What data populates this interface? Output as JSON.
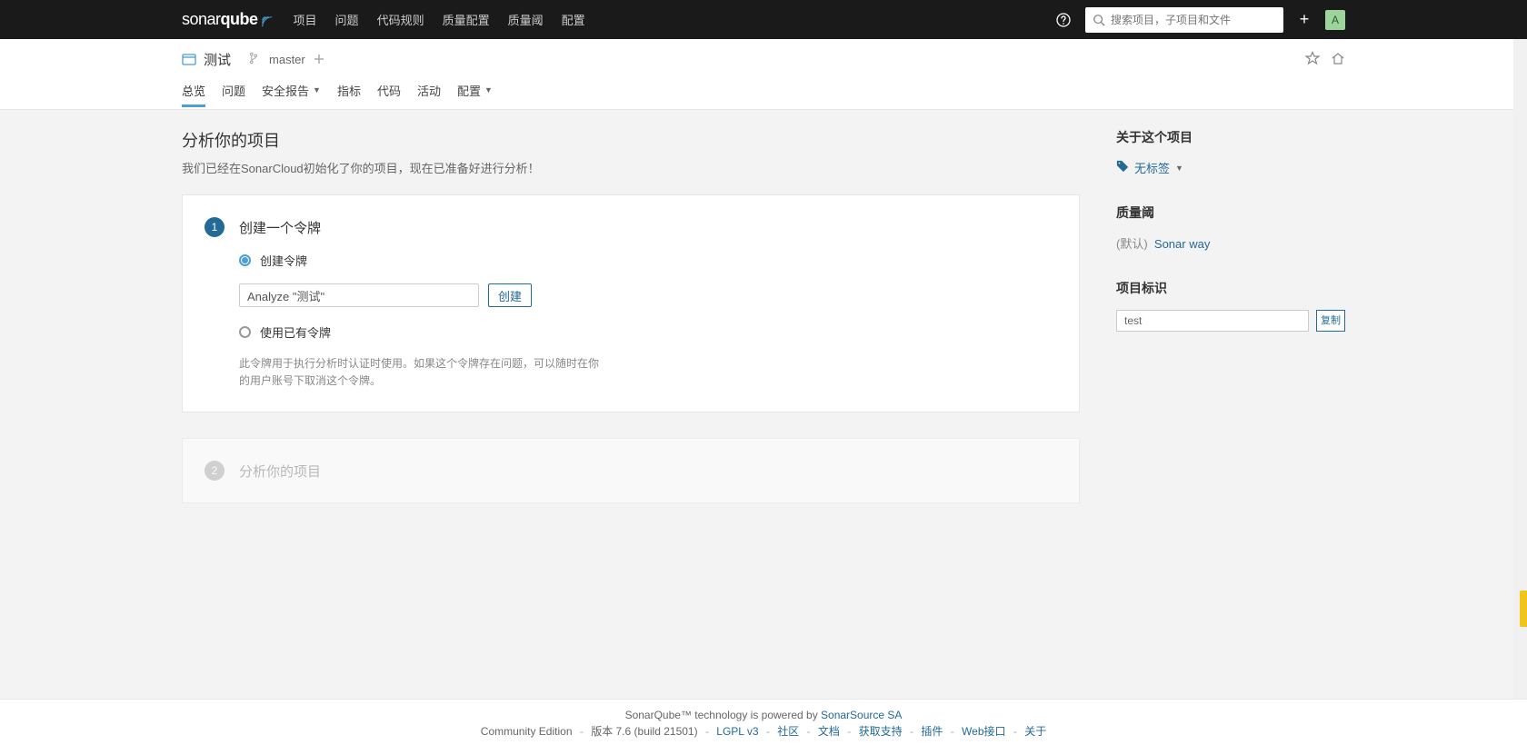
{
  "topnav": {
    "brand_sonar": "sonar",
    "brand_qube": "qube",
    "items": [
      "项目",
      "问题",
      "代码规则",
      "质量配置",
      "质量阈",
      "配置"
    ],
    "search_placeholder": "搜索项目，子项目和文件",
    "avatar_letter": "A"
  },
  "project": {
    "name": "测试",
    "branch": "master",
    "tabs": [
      "总览",
      "问题",
      "安全报告",
      "指标",
      "代码",
      "活动",
      "配置"
    ],
    "tabs_dd": [
      false,
      false,
      true,
      false,
      false,
      false,
      true
    ],
    "active_tab": 0
  },
  "main": {
    "title": "分析你的项目",
    "desc": "我们已经在SonarCloud初始化了你的项目，现在已准备好进行分析！",
    "step1": {
      "num": "1",
      "title": "创建一个令牌",
      "radio_create": "创建令牌",
      "token_value": "Analyze \"测试\"",
      "create_btn": "创建",
      "radio_use": "使用已有令牌",
      "hint": "此令牌用于执行分析时认证时使用。如果这个令牌存在问题，可以随时在你的用户账号下取消这个令牌。"
    },
    "step2": {
      "num": "2",
      "title": "分析你的项目"
    }
  },
  "side": {
    "about_title": "关于这个项目",
    "tags_label": "无标签",
    "gate_title": "质量阈",
    "gate_default": "(默认)",
    "gate_link": "Sonar way",
    "key_title": "项目标识",
    "key_value": "test",
    "copy_label": "复制"
  },
  "footer": {
    "line1_a": "SonarQube™ technology is powered by ",
    "line1_link": "SonarSource SA",
    "edition": "Community Edition",
    "version_text": "版本 7.6 (build 21501)",
    "links": [
      "LGPL v3",
      "社区",
      "文档",
      "获取支持",
      "插件",
      "Web接口",
      "关于"
    ]
  }
}
